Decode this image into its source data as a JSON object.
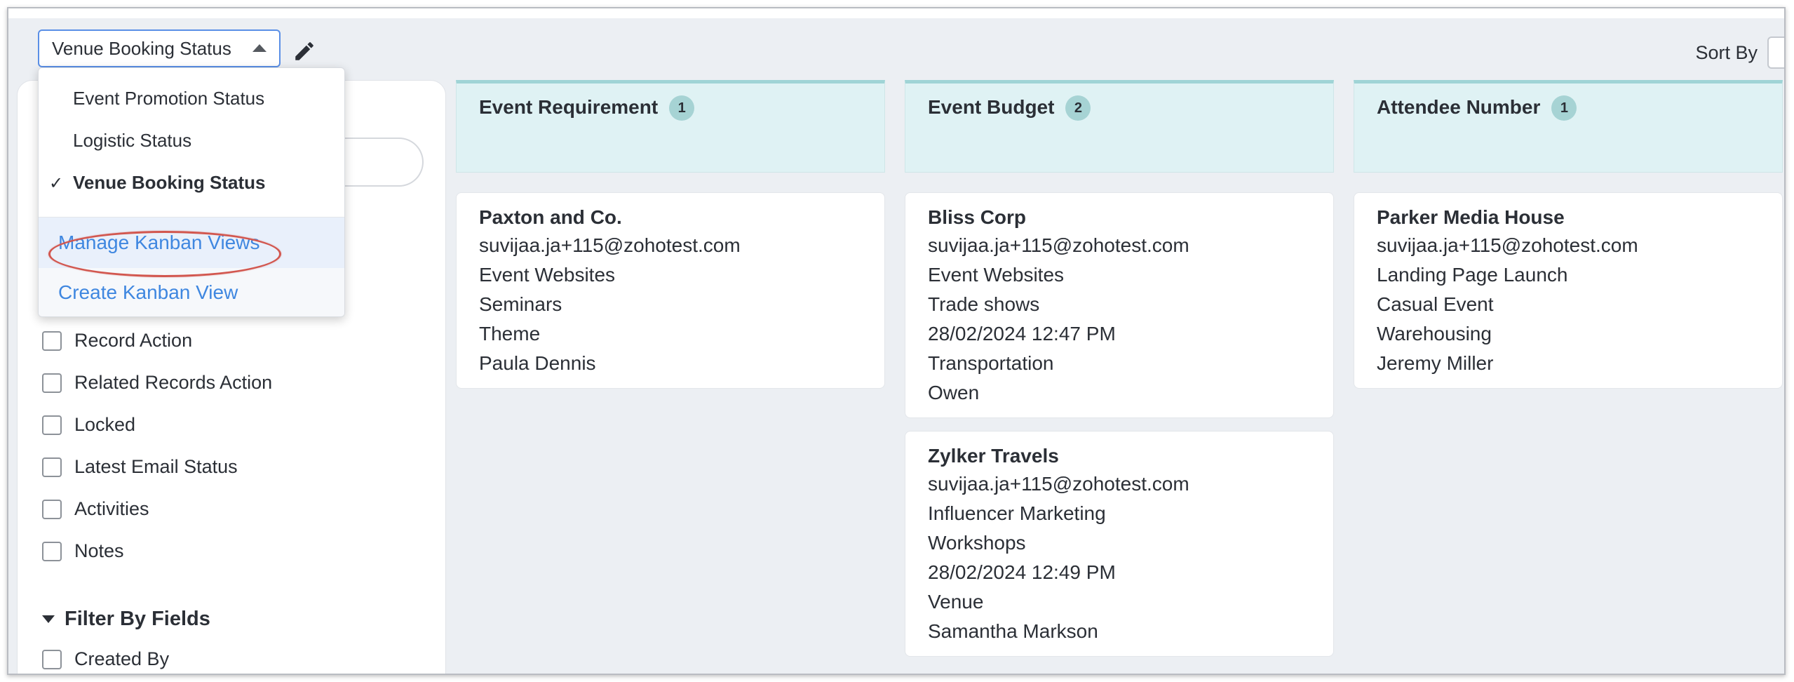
{
  "view_selector": {
    "label": "Venue Booking Status"
  },
  "sort": {
    "label": "Sort By"
  },
  "dropdown": {
    "options": [
      {
        "label": "Event Promotion Status",
        "selected": false
      },
      {
        "label": "Logistic Status",
        "selected": false
      },
      {
        "label": "Venue Booking Status",
        "selected": true
      }
    ],
    "check_glyph": "✓",
    "manage_label": "Manage Kanban Views",
    "create_label": "Create Kanban View"
  },
  "filters": {
    "items": [
      "Record Action",
      "Related Records Action",
      "Locked",
      "Latest Email Status",
      "Activities",
      "Notes"
    ],
    "section_title": "Filter By Fields",
    "field_items": [
      "Created By"
    ]
  },
  "columns": [
    {
      "title": "Event Requirement",
      "count": "1",
      "cards": [
        {
          "title": "Paxton and Co.",
          "lines": [
            "suvijaa.ja+115@zohotest.com",
            "Event Websites",
            "Seminars",
            "Theme",
            "Paula Dennis"
          ]
        }
      ]
    },
    {
      "title": "Event Budget",
      "count": "2",
      "cards": [
        {
          "title": "Bliss Corp",
          "lines": [
            "suvijaa.ja+115@zohotest.com",
            "Event Websites",
            "Trade shows",
            "28/02/2024 12:47 PM",
            "Transportation",
            "Owen"
          ]
        },
        {
          "title": "Zylker Travels",
          "lines": [
            "suvijaa.ja+115@zohotest.com",
            "Influencer Marketing",
            "Workshops",
            "28/02/2024 12:49 PM",
            "Venue",
            "Samantha Markson"
          ]
        }
      ]
    },
    {
      "title": "Attendee Number",
      "count": "1",
      "cards": [
        {
          "title": "Parker Media House",
          "lines": [
            "suvijaa.ja+115@zohotest.com",
            "Landing Page Launch",
            "Casual Event",
            "Warehousing",
            "Jeremy Miller"
          ]
        }
      ]
    }
  ],
  "colors": {
    "accent_link": "#3f87e0",
    "column_header_bg": "#dff2f4",
    "highlight_oval": "#d2574f"
  },
  "icons": {
    "edit": "pencil-icon",
    "selector_caret": "caret-up-icon"
  }
}
